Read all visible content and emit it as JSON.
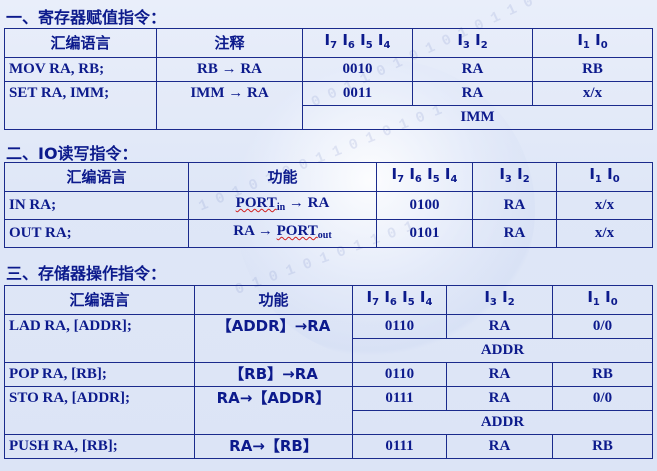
{
  "section1": {
    "title": "一、寄存器赋值指令：",
    "headers": {
      "asm": "汇编语言",
      "note": "注释",
      "i7_4": "I7 I6 I5 I4",
      "i3_2": "I3 I2",
      "i1_0": "I1 I0"
    },
    "rows": [
      {
        "asm": "MOV  RA, RB;",
        "note": "RB → RA",
        "op": "0010",
        "i32": "RA",
        "i10": "RB"
      },
      {
        "asm": "SET  RA, IMM;",
        "note": "IMM → RA",
        "op": "0011",
        "i32": "RA",
        "i10": "x/x",
        "extra": "IMM"
      }
    ]
  },
  "section2": {
    "title": "二、IO读写指令：",
    "headers": {
      "asm": "汇编语言",
      "func": "功能"
    },
    "rows": [
      {
        "asm": "IN  RA;",
        "func_a": "PORT",
        "func_sub": "in",
        "func_b": " → RA",
        "op": "0100",
        "i32": "RA",
        "i10": "x/x"
      },
      {
        "asm": "OUT  RA;",
        "func_a": "RA → ",
        "func_b": "PORT",
        "func_sub": "out",
        "op": "0101",
        "i32": "RA",
        "i10": "x/x"
      }
    ]
  },
  "section3": {
    "title": "三、存储器操作指令：",
    "headers": {
      "asm": "汇编语言",
      "func": "功能"
    },
    "rows": [
      {
        "asm": "LAD  RA, [ADDR];",
        "func": "【ADDR】→RA",
        "op": "0110",
        "i32": "RA",
        "i10": "0/0",
        "extra": "ADDR"
      },
      {
        "asm": "POP  RA, [RB];",
        "func": "【RB】→RA",
        "op": "0110",
        "i32": "RA",
        "i10": "RB"
      },
      {
        "asm": "STO  RA, [ADDR];",
        "func": "RA→【ADDR】",
        "op": "0111",
        "i32": "RA",
        "i10": "0/0",
        "extra": "ADDR"
      },
      {
        "asm": "PUSH  RA, [RB];",
        "func": "RA→【RB】",
        "op": "0111",
        "i32": "RA",
        "i10": "RB"
      }
    ]
  }
}
